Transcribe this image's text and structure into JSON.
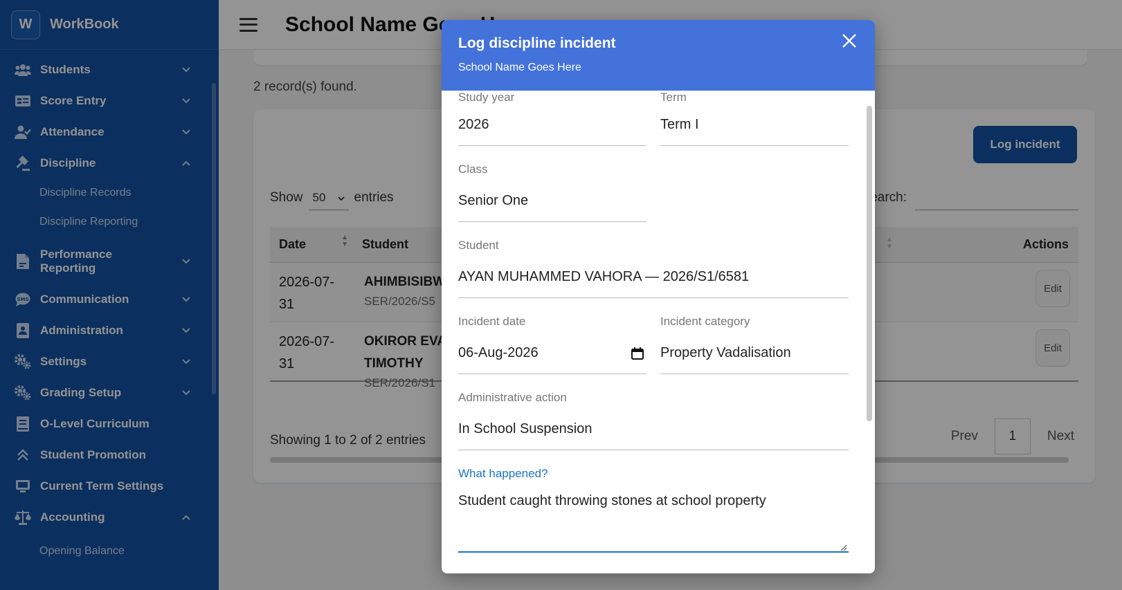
{
  "app": {
    "logo_letter": "W",
    "name": "WorkBook"
  },
  "sidebar": {
    "items": [
      {
        "label": "Students",
        "icon": "users-icon",
        "expanded": false
      },
      {
        "label": "Score Entry",
        "icon": "score-icon",
        "expanded": false
      },
      {
        "label": "Attendance",
        "icon": "user-check-icon",
        "expanded": false
      },
      {
        "label": "Discipline",
        "icon": "gavel-icon",
        "expanded": true,
        "children": [
          "Discipline Records",
          "Discipline Reporting"
        ]
      },
      {
        "label": "Performance Reporting",
        "icon": "file-report-icon",
        "expanded": false
      },
      {
        "label": "Communication",
        "icon": "chat-icon",
        "expanded": false
      },
      {
        "label": "Administration",
        "icon": "admin-icon",
        "expanded": false
      },
      {
        "label": "Settings",
        "icon": "gears-icon",
        "expanded": false
      },
      {
        "label": "Grading Setup",
        "icon": "gears-icon",
        "expanded": false
      },
      {
        "label": "O-Level Curriculum",
        "icon": "book-icon",
        "expanded": false
      },
      {
        "label": "Student Promotion",
        "icon": "chevrons-up-icon",
        "expanded": false
      },
      {
        "label": "Current Term Settings",
        "icon": "laptop-icon",
        "expanded": false
      },
      {
        "label": "Accounting",
        "icon": "scale-icon",
        "expanded": true,
        "children": [
          "Opening Balance"
        ]
      }
    ]
  },
  "topbar": {
    "title": "School Name Goes Here"
  },
  "records_found": "2 record(s) found.",
  "card": {
    "log_button": "Log incident",
    "show_label": "Show",
    "entries_value": "50",
    "entries_label": "entries",
    "search_label": "Search:",
    "columns": {
      "date": "Date",
      "student": "Student",
      "actions": "Actions"
    },
    "rows": [
      {
        "date": "2026-07-31",
        "student": "AHIMBISIBWE",
        "reg": "SER/2026/S5",
        "action": "Edit"
      },
      {
        "date": "2026-07-31",
        "student": "OKIROR EVA TIMOTHY",
        "reg": "SER/2026/S1",
        "action": "Edit"
      }
    ],
    "showing": "Showing 1 to 2 of 2 entries",
    "pager": {
      "prev": "Prev",
      "page": "1",
      "next": "Next"
    }
  },
  "modal": {
    "title": "Log discipline incident",
    "subtitle": "School Name Goes Here",
    "fields": {
      "study_year": {
        "label": "Study year",
        "value": "2026"
      },
      "term": {
        "label": "Term",
        "value": "Term I"
      },
      "class": {
        "label": "Class",
        "value": "Senior One"
      },
      "student": {
        "label": "Student",
        "value": "AYAN MUHAMMED VAHORA — 2026/S1/6581"
      },
      "incident_date": {
        "label": "Incident date",
        "value": "06-Aug-2026"
      },
      "incident_category": {
        "label": "Incident category",
        "value": "Property Vadalisation"
      },
      "admin_action": {
        "label": "Administrative action",
        "value": "In School Suspension"
      },
      "what_happened": {
        "label": "What happened?",
        "value": "Student caught throwing stones at school property"
      }
    }
  },
  "colors": {
    "sidebar_bg": "#1452a3",
    "modal_header": "#4472db",
    "focus_blue": "#1a73c8"
  }
}
